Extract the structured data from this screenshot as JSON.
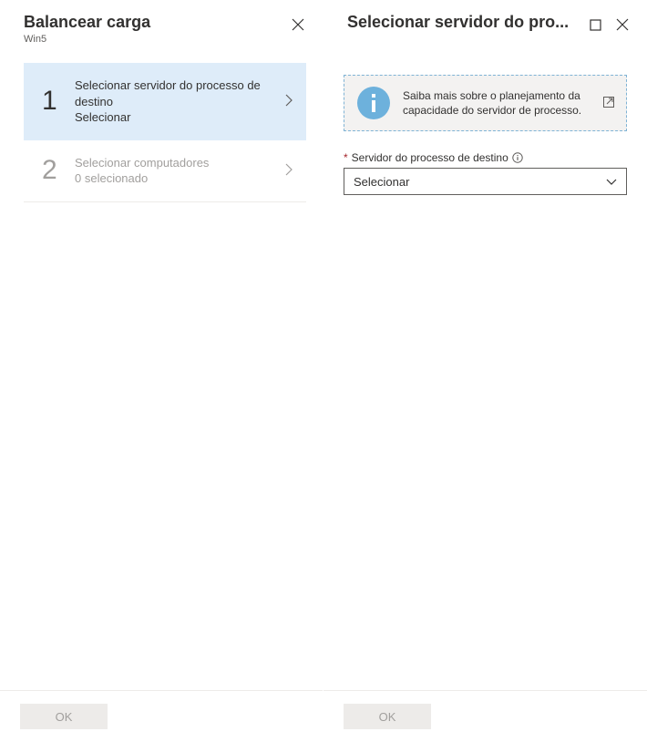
{
  "left": {
    "title": "Balancear carga",
    "subtitle": "Win5",
    "steps": [
      {
        "num": "1",
        "title": "Selecionar servidor do processo de destino",
        "sub": "Selecionar",
        "active": true
      },
      {
        "num": "2",
        "title": "Selecionar computadores",
        "sub": "0 selecionado",
        "active": false
      }
    ],
    "ok": "OK"
  },
  "right": {
    "title": "Selecionar servidor do pro...",
    "callout": {
      "text": "Saiba mais sobre o planejamento da capacidade do servidor de processo."
    },
    "field": {
      "required": "*",
      "label": "Servidor do processo de destino",
      "value": "Selecionar"
    },
    "ok": "OK"
  }
}
